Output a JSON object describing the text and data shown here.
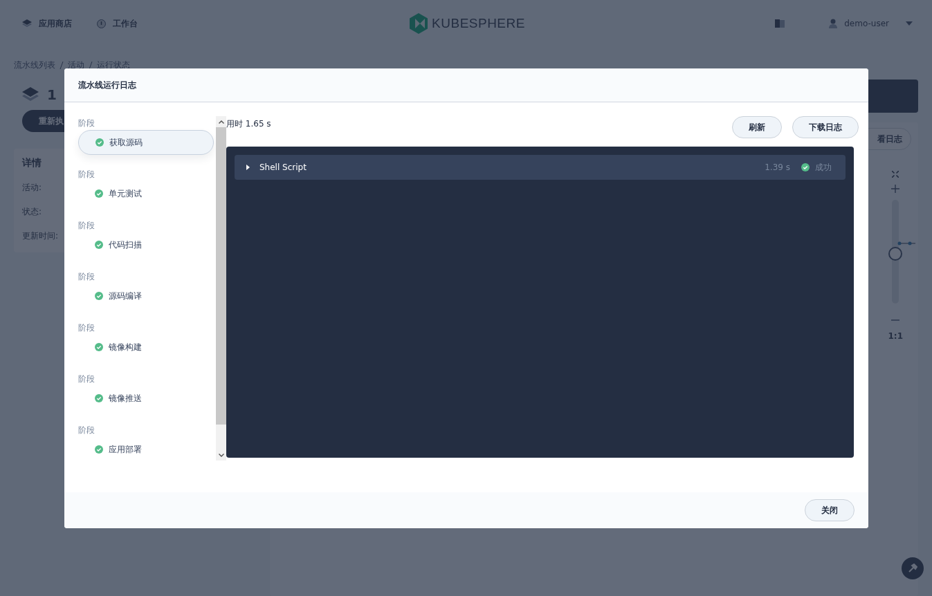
{
  "nav": {
    "items": [
      {
        "label": "应用商店",
        "kind": "store"
      },
      {
        "label": "工作台",
        "kind": "desk"
      }
    ],
    "logo": "KUBESPHERE",
    "user": "demo-user"
  },
  "breadcrumb": [
    "流水线列表",
    "活动",
    "运行状态"
  ],
  "run_card": {
    "title": "1",
    "rerun_button": "重新执",
    "details_title": "详情",
    "fields": [
      "活动:",
      "状态:",
      "更新时间:"
    ]
  },
  "side_button": "看日志",
  "zoom": {
    "level": 0.48,
    "ratio": "1:1"
  },
  "dialog": {
    "title": "流水线运行日志",
    "stages": [
      {
        "label": "阶段",
        "name": "获取源码",
        "selected": true
      },
      {
        "label": "阶段",
        "name": "单元测试",
        "selected": false
      },
      {
        "label": "阶段",
        "name": "代码扫描",
        "selected": false
      },
      {
        "label": "阶段",
        "name": "源码编译",
        "selected": false
      },
      {
        "label": "阶段",
        "name": "镜像构建",
        "selected": false
      },
      {
        "label": "阶段",
        "name": "镜像推送",
        "selected": false
      },
      {
        "label": "阶段",
        "name": "应用部署",
        "selected": false
      }
    ],
    "elapsed": "用时 1.65 s",
    "buttons": [
      "刷新",
      "下载日志"
    ],
    "steps": [
      {
        "name": "Shell Script",
        "duration": "1.39 s",
        "status_text": "成功",
        "expanded": false
      }
    ],
    "close_button": "关闭"
  }
}
